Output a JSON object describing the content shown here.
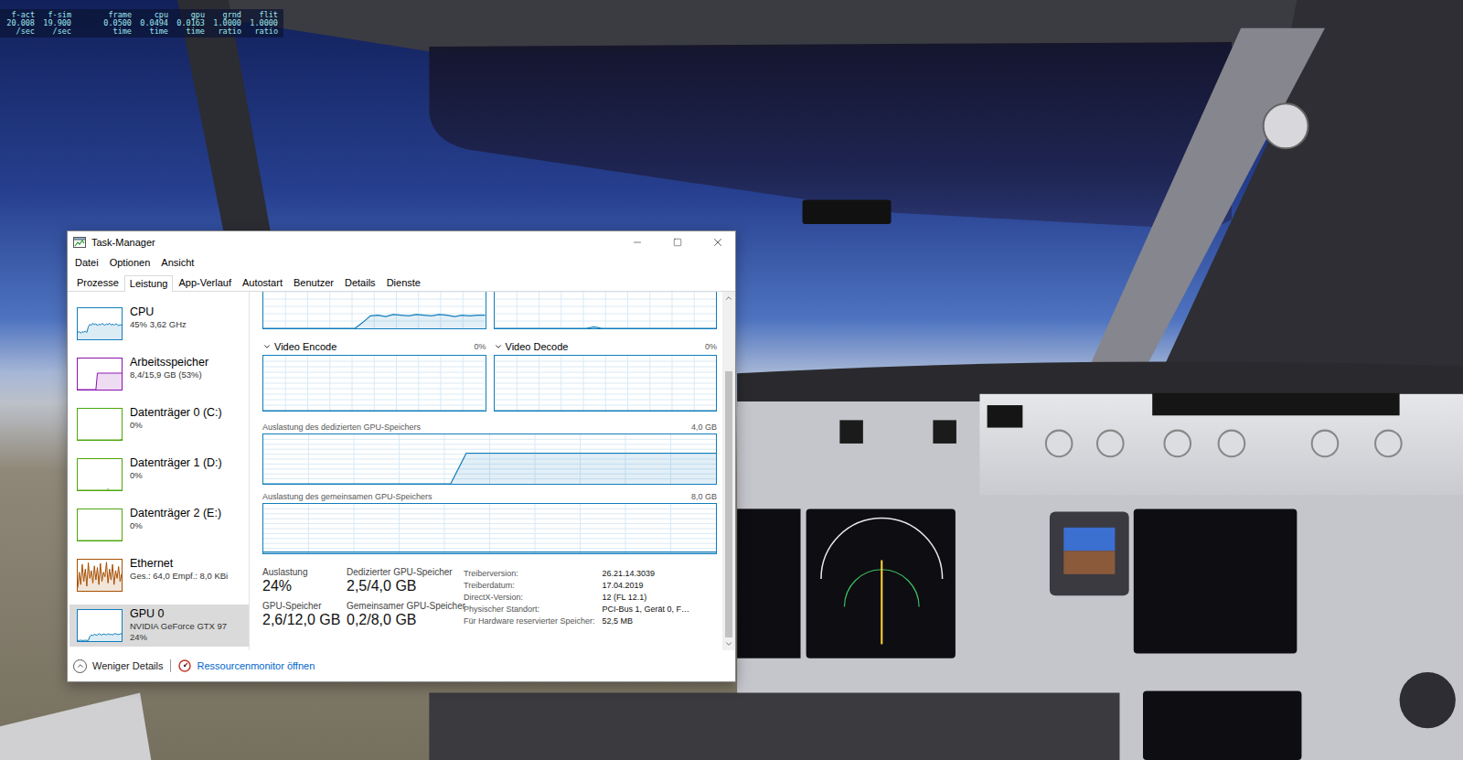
{
  "hud": {
    "columns": [
      {
        "label": "f-act",
        "value": "20.008",
        "unit": "/sec"
      },
      {
        "label": "f-sim",
        "value": "19.900",
        "unit": "/sec"
      },
      {
        "label": "frame",
        "value": "0.0500",
        "unit": "time"
      },
      {
        "label": "cpu",
        "value": "0.0494",
        "unit": "time"
      },
      {
        "label": "gpu",
        "value": "0.0163",
        "unit": "time"
      },
      {
        "label": "grnd",
        "value": "1.0000",
        "unit": "ratio"
      },
      {
        "label": "flit",
        "value": "1.0000",
        "unit": "ratio"
      }
    ]
  },
  "window": {
    "title": "Task-Manager"
  },
  "menu": [
    "Datei",
    "Optionen",
    "Ansicht"
  ],
  "tabs": [
    {
      "label": "Prozesse",
      "selected": false
    },
    {
      "label": "Leistung",
      "selected": true
    },
    {
      "label": "App-Verlauf",
      "selected": false
    },
    {
      "label": "Autostart",
      "selected": false
    },
    {
      "label": "Benutzer",
      "selected": false
    },
    {
      "label": "Details",
      "selected": false
    },
    {
      "label": "Dienste",
      "selected": false
    }
  ],
  "sidebar": {
    "items": [
      {
        "name": "CPU",
        "details": [
          "45% 3,62 GHz"
        ],
        "color": "#117dbb",
        "selected": false,
        "values": [
          22,
          25,
          20,
          24,
          23,
          26,
          22,
          40,
          48,
          45,
          52,
          47,
          50,
          44,
          49,
          46,
          51,
          48,
          45,
          50,
          47,
          52,
          46,
          49,
          45,
          50,
          48,
          44,
          47,
          45
        ]
      },
      {
        "name": "Arbeitsspeicher",
        "details": [
          "8,4/15,9 GB (53%)"
        ],
        "color": "#8b12ae",
        "selected": false,
        "values": [
          0,
          0,
          0,
          0,
          0,
          0,
          0,
          0,
          0,
          0,
          0,
          0,
          0,
          53,
          53,
          53,
          53,
          53,
          53,
          53,
          53,
          53,
          53,
          53,
          53,
          53,
          53,
          53,
          53,
          53
        ]
      },
      {
        "name": "Datenträger 0 (C:)",
        "details": [
          "0%"
        ],
        "color": "#4da60c",
        "selected": false,
        "values": [
          0,
          0,
          0,
          0,
          0,
          0,
          0,
          0,
          0,
          0,
          0,
          0,
          0,
          0,
          0,
          0,
          0,
          0,
          0,
          0,
          0,
          0,
          0,
          0,
          0,
          0,
          0,
          0,
          0,
          2
        ]
      },
      {
        "name": "Datenträger 1 (D:)",
        "details": [
          "0%"
        ],
        "color": "#4da60c",
        "selected": false,
        "values": [
          0,
          0,
          0,
          0,
          0,
          0,
          0,
          0,
          0,
          0,
          0,
          0,
          0,
          0,
          0,
          0,
          0,
          0,
          0,
          0,
          4,
          0,
          0,
          0,
          0,
          0,
          0,
          0,
          0,
          0
        ]
      },
      {
        "name": "Datenträger 2 (E:)",
        "details": [
          "0%"
        ],
        "color": "#4da60c",
        "selected": false,
        "values": [
          0,
          0,
          0,
          0,
          0,
          0,
          0,
          0,
          0,
          0,
          0,
          0,
          0,
          0,
          0,
          0,
          0,
          0,
          0,
          0,
          0,
          0,
          0,
          0,
          0,
          0,
          0,
          0,
          0,
          0
        ]
      },
      {
        "name": "Ethernet",
        "details": [
          "Ges.: 64,0 Empf.: 8,0 KBi"
        ],
        "color": "#a74f01",
        "selected": false,
        "values": [
          10,
          60,
          20,
          85,
          30,
          70,
          15,
          90,
          40,
          65,
          25,
          80,
          35,
          75,
          20,
          88,
          30,
          60,
          45,
          92,
          25,
          70,
          35,
          85,
          20,
          65,
          40,
          78,
          30,
          55
        ]
      },
      {
        "name": "GPU 0",
        "details": [
          "NVIDIA GeForce GTX 97",
          "24%"
        ],
        "color": "#117dbb",
        "selected": true,
        "values": [
          2,
          2,
          3,
          2,
          2,
          3,
          2,
          2,
          15,
          20,
          18,
          22,
          20,
          19,
          24,
          21,
          20,
          23,
          22,
          20,
          24,
          21,
          22,
          20,
          23,
          24,
          22,
          21,
          23,
          24
        ]
      }
    ]
  },
  "pane": {
    "color": "#117dbb",
    "top_graphs": [
      {
        "values": [
          0,
          0,
          0,
          0,
          0,
          0,
          0,
          0,
          0,
          0,
          0,
          0,
          0,
          8,
          17,
          18,
          16,
          19,
          18,
          17,
          19,
          18,
          17,
          19,
          18,
          16,
          18,
          17,
          18,
          18
        ]
      },
      {
        "values": [
          0,
          0,
          0,
          0,
          0,
          0,
          0,
          0,
          0,
          0,
          0,
          0,
          0,
          2,
          0,
          0,
          0,
          0,
          0,
          0,
          0,
          0,
          0,
          0,
          0,
          0,
          0,
          0,
          0,
          0
        ]
      }
    ],
    "engines": [
      {
        "label": "Video Encode",
        "reading": "0%",
        "values": [
          0,
          0,
          0,
          0,
          0,
          0,
          0,
          0,
          0,
          0,
          0,
          0,
          0,
          0,
          0,
          0,
          0,
          0,
          0,
          0,
          0,
          0,
          0,
          0,
          0,
          0,
          0,
          0,
          0,
          0
        ]
      },
      {
        "label": "Video Decode",
        "reading": "0%",
        "values": [
          0,
          0,
          0,
          0,
          0,
          0,
          0,
          0,
          0,
          0,
          0,
          0,
          0,
          0,
          0,
          0,
          0,
          0,
          0,
          0,
          0,
          0,
          0,
          0,
          0,
          0,
          0,
          0,
          0,
          0
        ]
      }
    ],
    "memory_graphs": [
      {
        "label": "Auslastung des dedizierten GPU-Speichers",
        "max": "4,0 GB",
        "values": [
          0,
          0,
          0,
          0,
          0,
          0,
          0,
          0,
          0,
          0,
          0,
          0,
          0,
          62,
          62,
          62,
          62,
          62,
          62,
          62,
          62,
          62,
          62,
          62,
          62,
          62,
          62,
          62,
          62,
          62
        ]
      },
      {
        "label": "Auslastung des gemeinsamen GPU-Speichers",
        "max": "8,0 GB",
        "values": [
          2.5,
          2.5,
          2.5,
          2.5,
          2.5,
          2.5,
          2.5,
          2.5,
          2.5,
          2.5,
          2.5,
          2.5,
          2.5,
          2.5,
          2.5,
          2.5,
          2.5,
          2.5,
          2.5,
          2.5,
          2.5,
          2.5,
          2.5,
          2.5,
          2.5,
          2.5,
          2.5,
          2.5,
          2.5,
          2.5
        ]
      }
    ],
    "stats": [
      {
        "label": "Auslastung",
        "value": "24%"
      },
      {
        "label": "Dedizierter GPU-Speicher",
        "value": "2,5/4,0 GB"
      },
      {
        "label": "GPU-Speicher",
        "value": "2,6/12,0 GB"
      },
      {
        "label": "Gemeinsamer GPU-Speicher",
        "value": "0,2/8,0 GB"
      }
    ],
    "details": [
      {
        "label": "Treiberversion:",
        "value": "26.21.14.3039"
      },
      {
        "label": "Treiberdatum:",
        "value": "17.04.2019"
      },
      {
        "label": "DirectX-Version:",
        "value": "12 (FL 12.1)"
      },
      {
        "label": "Physischer Standort:",
        "value": "PCI-Bus 1, Gerät 0, F…"
      },
      {
        "label": "Für Hardware reservierter Speicher:",
        "value": "52,5 MB"
      }
    ]
  },
  "scrollbar": {
    "thumb_start": 0.2,
    "thumb_size": 0.8
  },
  "footer": {
    "toggle": "Weniger Details",
    "link": "Ressourcenmonitor öffnen"
  }
}
